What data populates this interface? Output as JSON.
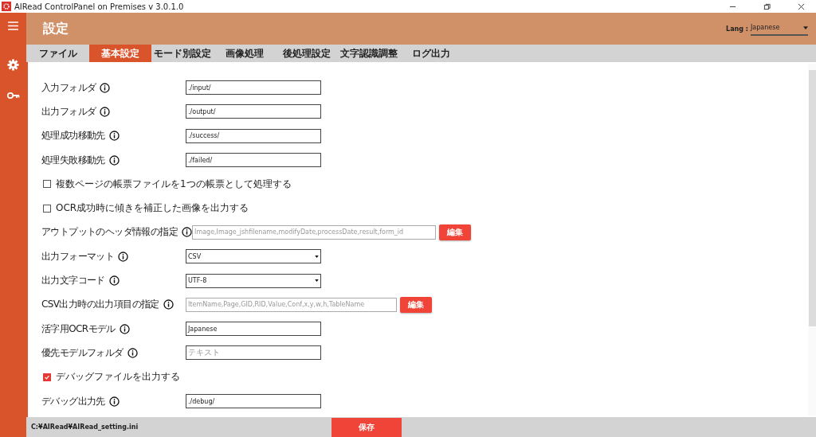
{
  "window": {
    "title": "AIRead ControlPanel on Premises v 3.0.1.0"
  },
  "header": {
    "title": "設定",
    "lang_label": "Lang :",
    "lang_value": "Japanese"
  },
  "tabs": [
    {
      "label": "ファイル",
      "selected": false
    },
    {
      "label": "基本設定",
      "selected": true
    },
    {
      "label": "モード別設定",
      "selected": false
    },
    {
      "label": "画像処理",
      "selected": false
    },
    {
      "label": "後処理設定",
      "selected": false
    },
    {
      "label": "文字認識調整",
      "selected": false
    },
    {
      "label": "ログ出力",
      "selected": false
    }
  ],
  "settings": [
    {
      "kind": "text",
      "label": "入力フォルダ",
      "value": "./input/"
    },
    {
      "kind": "text",
      "label": "出力フォルダ",
      "value": "./output/"
    },
    {
      "kind": "text",
      "label": "処理成功移動先",
      "value": "./success/"
    },
    {
      "kind": "text",
      "label": "処理失敗移動先",
      "value": "./failed/"
    },
    {
      "kind": "checkbox",
      "label": "複数ページの帳票ファイルを1つの帳票として処理する",
      "checked": false
    },
    {
      "kind": "checkbox",
      "label": "OCR成功時に傾きを補正した画像を出力する",
      "checked": false
    },
    {
      "kind": "edit",
      "label": "アウトプットのヘッダ情報の指定",
      "placeholder": "Image,Image_jshfilename,modifyDate,processDate,result,form_id",
      "button": "編集"
    },
    {
      "kind": "select",
      "label": "出力フォーマット",
      "value": "CSV"
    },
    {
      "kind": "select",
      "label": "出力文字コード",
      "value": "UTF-8"
    },
    {
      "kind": "edit",
      "label": "CSV出力時の出力項目の指定",
      "placeholder": "ItemName,Page,GID,RID,Value,Conf,x,y,w,h,TableName",
      "button": "編集"
    },
    {
      "kind": "text",
      "label": "活字用OCRモデル",
      "value": "Japanese"
    },
    {
      "kind": "text",
      "label": "優先モデルフォルダ",
      "placeholder": "テキスト"
    },
    {
      "kind": "checkbox",
      "label": "デバッグファイルを出力する",
      "checked": true
    },
    {
      "kind": "text",
      "label": "デバッグ出力先",
      "value": "./debug/"
    }
  ],
  "footer": {
    "path": "C:¥AIRead¥AIRead_setting.ini",
    "save": "保存"
  }
}
